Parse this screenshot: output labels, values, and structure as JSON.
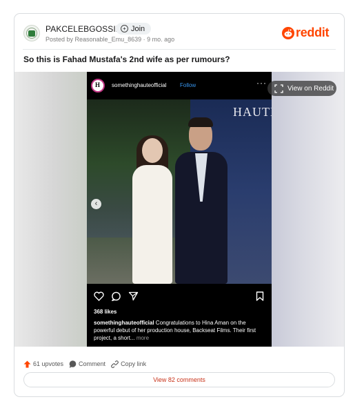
{
  "header": {
    "subreddit": "PAKCELEBGOSSIP",
    "join_label": "Join",
    "posted_by": "Posted by Reasonable_Emu_8639 · 9 mo. ago",
    "brand": "reddit"
  },
  "post": {
    "title": "So this is Fahad Mustafa's 2nd wife as per rumours?"
  },
  "media": {
    "view_on_reddit": "View on Reddit",
    "instagram": {
      "avatar_letter": "H",
      "username": "somethinghauteofficial",
      "follow": "Follow",
      "more_dots": "···",
      "backdrop_text": "HAUTE",
      "likes": "368 likes",
      "caption_user": "somethinghauteofficial",
      "caption_text": " Congratulations to Hina Aman on the powerful debut of her production house, Backseat Films. Their first project, a short...",
      "caption_more": " more"
    }
  },
  "footer": {
    "upvotes": "61 upvotes",
    "comment": "Comment",
    "copy_link": "Copy link",
    "view_comments": "View 82 comments"
  },
  "colors": {
    "brand": "#ff4500",
    "link": "#3897f0",
    "comments_text": "#c8331a"
  }
}
